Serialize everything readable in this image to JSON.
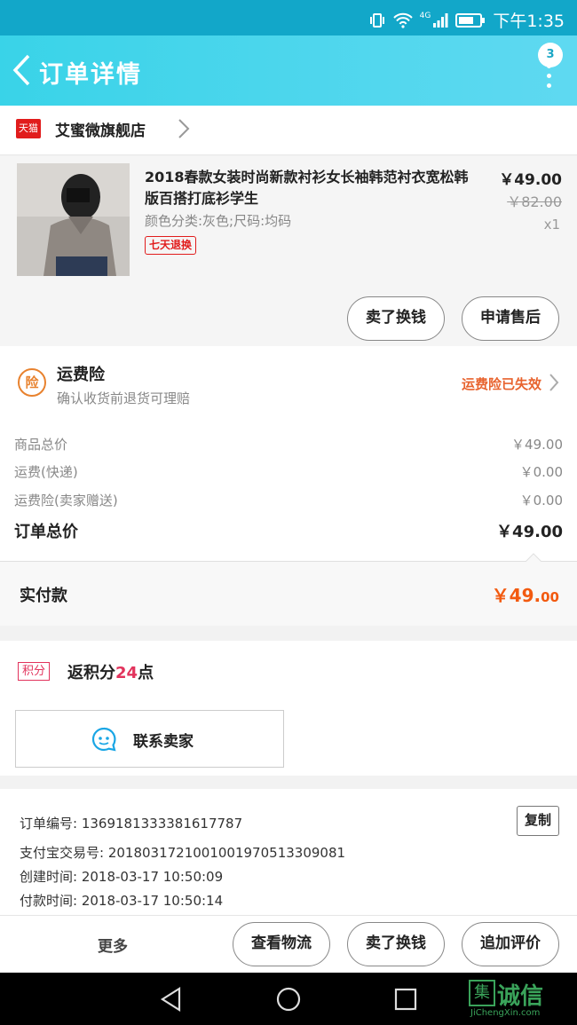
{
  "status_bar": {
    "network": "4G",
    "time": "下午1:35"
  },
  "header": {
    "title": "订单详情",
    "badge_count": "3"
  },
  "store": {
    "platform_badge": "天猫",
    "name": "艾蜜微旗舰店"
  },
  "product": {
    "title": "2018春款女装时尚新款衬衫女长袖韩范衬衣宽松韩版百搭打底衫学生",
    "sku": "颜色分类:灰色;尺码:均码",
    "tag": "七天退换",
    "price": "￥49.00",
    "original_price": "￥82.00",
    "quantity": "x1",
    "buttons": [
      "卖了换钱",
      "申请售后"
    ]
  },
  "insurance": {
    "icon_text": "险",
    "title": "运费险",
    "description": "确认收货前退货可理赔",
    "status": "运费险已失效"
  },
  "fees": [
    {
      "label": "商品总价",
      "value": "￥49.00"
    },
    {
      "label": "运费(快递)",
      "value": "￥0.00"
    },
    {
      "label": "运费险(卖家赠送)",
      "value": "￥0.00"
    }
  ],
  "order_total": {
    "label": "订单总价",
    "value": "￥49.00"
  },
  "paid": {
    "label": "实付款",
    "amount_main": "￥49.",
    "amount_cents": "00"
  },
  "points": {
    "tag": "积分",
    "prefix": "返积分",
    "count": "24",
    "suffix": "点"
  },
  "contact": {
    "label": "联系卖家"
  },
  "order_info": {
    "order_no": "订单编号: 1369181333381617787",
    "alipay_no": "支付宝交易号: 2018031721001001970513309081",
    "created": "创建时间: 2018-03-17 10:50:09",
    "paid_time": "付款时间: 2018-03-17 10:50:14",
    "copy_label": "复制"
  },
  "bottom_bar": {
    "more": "更多",
    "buttons": [
      "查看物流",
      "卖了换钱",
      "追加评价"
    ]
  },
  "watermark": {
    "cn": "诚信",
    "box": "集",
    "en": "JiChengXin.com"
  },
  "colors": {
    "status_bar": "#12a7c9",
    "header": "#39d3e8",
    "accent_orange": "#f25a10",
    "tmall_red": "#e11c1c",
    "points_pink": "#e2335c"
  }
}
